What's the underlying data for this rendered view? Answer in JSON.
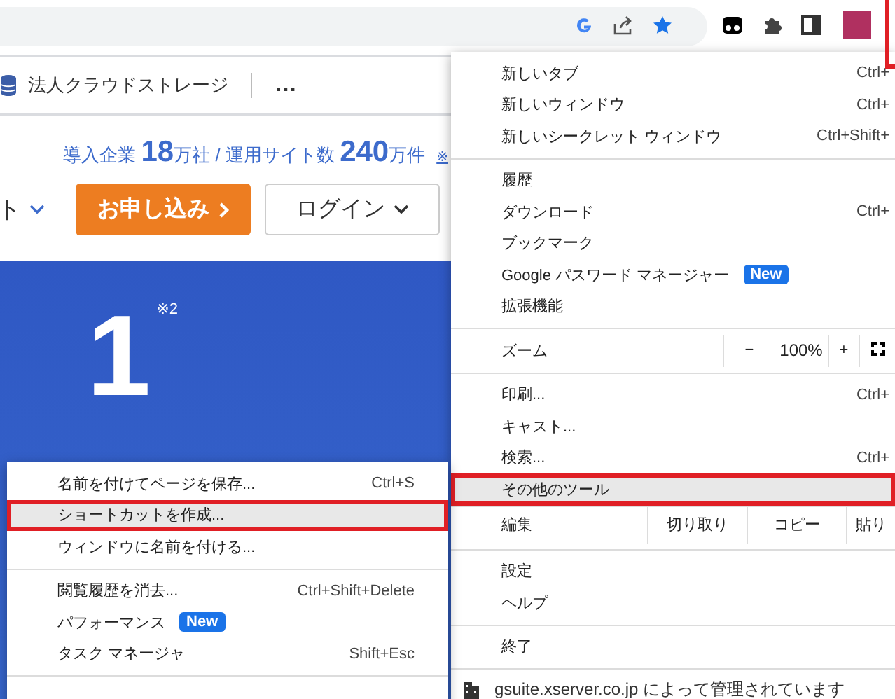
{
  "bookmarks_bar": {
    "items": [
      {
        "label": "法人クラウドストレージ"
      }
    ],
    "more": "…"
  },
  "page": {
    "stats": "導入企業 **18**万社 / 運用サイト数 **240**万件",
    "stats_note": "※",
    "nav_partial": "ト",
    "apply_button": "お申し込み",
    "login_button": "ログイン",
    "hero_number": "1",
    "hero_note": "※2"
  },
  "main_menu": {
    "sections": [
      {
        "items": [
          {
            "kind": "item",
            "label": "新しいタブ",
            "shortcut": "Ctrl+",
            "selected": false
          },
          {
            "kind": "item",
            "label": "新しいウィンドウ",
            "shortcut": "Ctrl+",
            "selected": false
          },
          {
            "kind": "item",
            "label": "新しいシークレット ウィンドウ",
            "shortcut": "Ctrl+Shift+",
            "selected": false
          }
        ]
      },
      {
        "items": [
          {
            "kind": "item",
            "label": "履歴",
            "selected": false
          },
          {
            "kind": "item",
            "label": "ダウンロード",
            "shortcut": "Ctrl+",
            "selected": false
          },
          {
            "kind": "item",
            "label": "ブックマーク",
            "selected": false
          },
          {
            "kind": "item",
            "label": "Google パスワード マネージャー",
            "badge": "New",
            "selected": false
          },
          {
            "kind": "item",
            "label": "拡張機能",
            "selected": false
          }
        ]
      },
      {
        "items": [
          {
            "kind": "zoom",
            "label": "ズーム",
            "minus": "−",
            "value": "100%",
            "plus": "+"
          }
        ]
      },
      {
        "items": [
          {
            "kind": "item",
            "label": "印刷...",
            "shortcut": "Ctrl+",
            "selected": false
          },
          {
            "kind": "item",
            "label": "キャスト...",
            "selected": false
          },
          {
            "kind": "item",
            "label": "検索...",
            "shortcut": "Ctrl+",
            "selected": false
          },
          {
            "kind": "item",
            "label": "その他のツール",
            "selected": true
          },
          {
            "kind": "edit",
            "label": "編集",
            "actions": [
              "切り取り",
              "コピー",
              "貼り"
            ]
          }
        ]
      },
      {
        "items": [
          {
            "kind": "item",
            "label": "設定",
            "selected": false
          },
          {
            "kind": "item",
            "label": "ヘルプ",
            "selected": false
          }
        ]
      },
      {
        "items": [
          {
            "kind": "item",
            "label": "終了",
            "selected": false
          }
        ]
      }
    ],
    "footer": "gsuite.xserver.co.jp によって管理されています"
  },
  "sub_menu": {
    "sections": [
      {
        "items": [
          {
            "label": "名前を付けてページを保存...",
            "shortcut": "Ctrl+S",
            "selected": false
          },
          {
            "label": "ショートカットを作成...",
            "selected": true
          },
          {
            "label": "ウィンドウに名前を付ける...",
            "selected": false
          }
        ]
      },
      {
        "items": [
          {
            "label": "閲覧履歴を消去...",
            "shortcut": "Ctrl+Shift+Delete",
            "selected": false
          },
          {
            "label": "パフォーマンス",
            "badge": "New",
            "selected": false
          },
          {
            "label": "タスク マネージャ",
            "shortcut": "Shift+Esc",
            "selected": false
          }
        ]
      }
    ]
  }
}
